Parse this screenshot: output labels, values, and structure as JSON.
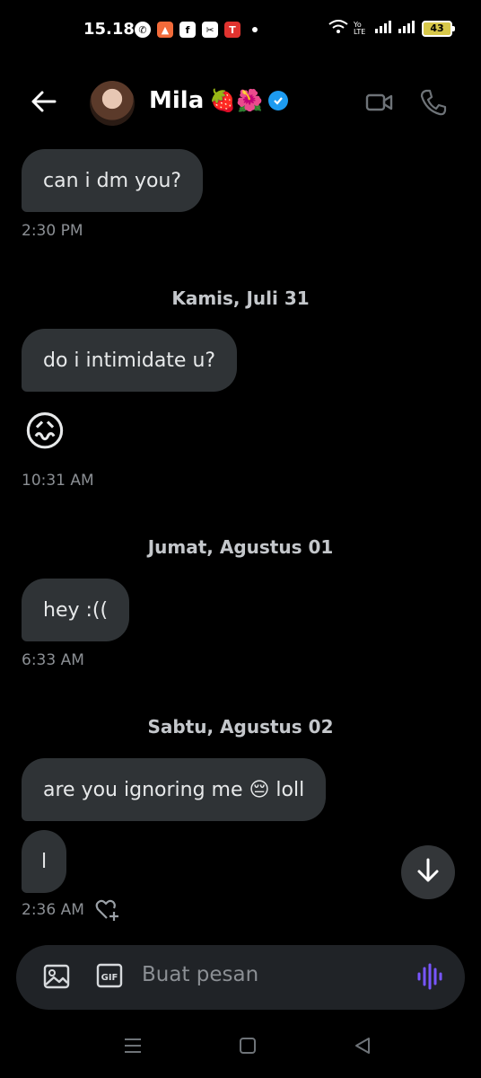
{
  "status_bar": {
    "time": "15.18",
    "battery": "43",
    "network_label": "Yo LTE"
  },
  "header": {
    "contact_name": "Mila",
    "name_emojis": "🍓🌺"
  },
  "messages": [
    {
      "text": "can i dm you?",
      "time": "2:30 PM"
    },
    {
      "date": "Kamis, Juli 31"
    },
    {
      "text": "do i intimidate u?"
    },
    {
      "emoji": "😖",
      "time": "10:31 AM"
    },
    {
      "date": "Jumat, Agustus 01"
    },
    {
      "text": "hey :((",
      "time": "6:33 AM"
    },
    {
      "date": "Sabtu, Agustus 02"
    },
    {
      "text": "are you ignoring me 😔 loll"
    },
    {
      "text": "l",
      "time": "2:36 AM"
    }
  ],
  "composer": {
    "placeholder": "Buat pesan"
  },
  "colors": {
    "background": "#000000",
    "bubble": "#2f3336",
    "verified_blue": "#1d9bf0",
    "voice_purple": "#7856ff"
  }
}
